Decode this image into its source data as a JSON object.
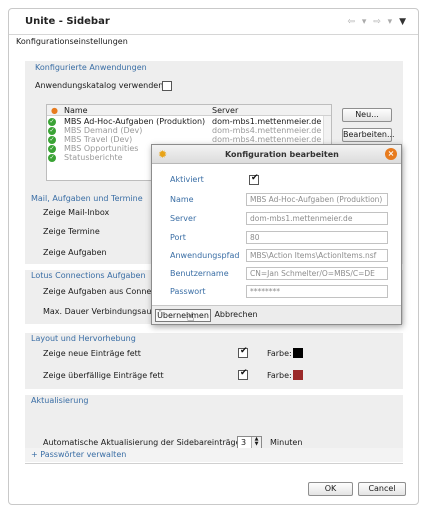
{
  "window": {
    "title": "Unite - Sidebar",
    "nav_back": "⇦ ▾",
    "nav_fwd": "⇨ ▾",
    "menu": "▼"
  },
  "heading": "Konfigurationseinstellungen",
  "apps": {
    "title": "Konfigurierte Anwendungen",
    "catalog_label": "Anwendungskatalog verwenden",
    "catalog_checked": false,
    "columns": [
      "Name",
      "Server"
    ],
    "rows": [
      {
        "name": "MBS Ad-Hoc-Aufgaben (Produktion)",
        "server": "dom-mbs1.mettenmeier.de",
        "dim": false
      },
      {
        "name": "MBS Demand (Dev)",
        "server": "dom-mbs4.mettenmeier.de",
        "dim": true
      },
      {
        "name": "MBS Travel (Dev)",
        "server": "dom-mbs4.mettenmeier.de",
        "dim": true
      },
      {
        "name": "MBS Opportunities",
        "server": "",
        "dim": true
      },
      {
        "name": "Statusberichte",
        "server": "",
        "dim": true
      }
    ],
    "btn_new": "Neu...",
    "btn_edit": "Bearbeiten..."
  },
  "mail": {
    "title": "Mail, Aufgaben und Termine",
    "inbox": "Zeige Mail-Inbox",
    "termine": "Zeige Termine",
    "aufgaben": "Zeige Aufgaben"
  },
  "lotus": {
    "title": "Lotus Connections Aufgaben",
    "show": "Zeige Aufgaben aus Connection",
    "maxdur": "Max. Dauer Verbindungsaufbau"
  },
  "layout": {
    "title": "Layout und Hervorhebung",
    "new_bold": "Zeige neue Einträge fett",
    "overdue_bold": "Zeige überfällige Einträge fett",
    "farbe": "Farbe:",
    "new_color": "#000000",
    "overdue_color": "#9b2a2a"
  },
  "refresh": {
    "title": "Aktualisierung",
    "label": "Automatische Aktualisierung der Sidebareinträge nach",
    "value": "3",
    "unit": "Minuten"
  },
  "passwords": {
    "link": "+ Passwörter verwalten"
  },
  "footer": {
    "ok": "OK",
    "cancel": "Cancel"
  },
  "dialog": {
    "title": "Konfiguration bearbeiten",
    "fields": [
      {
        "label": "Aktiviert",
        "value": "",
        "checkbox": true
      },
      {
        "label": "Name",
        "value": "MBS Ad-Hoc-Aufgaben (Produktion)"
      },
      {
        "label": "Server",
        "value": "dom-mbs1.mettenmeier.de"
      },
      {
        "label": "Port",
        "value": "80"
      },
      {
        "label": "Anwendungspfad",
        "value": "MBS\\Action Items\\ActionItems.nsf"
      },
      {
        "label": "Benutzername",
        "value": "CN=Jan Schmelter/O=MBS/C=DE"
      },
      {
        "label": "Passwort",
        "value": "********"
      }
    ],
    "btn_apply": "Übernehmen",
    "btn_cancel": "Abbrechen"
  }
}
